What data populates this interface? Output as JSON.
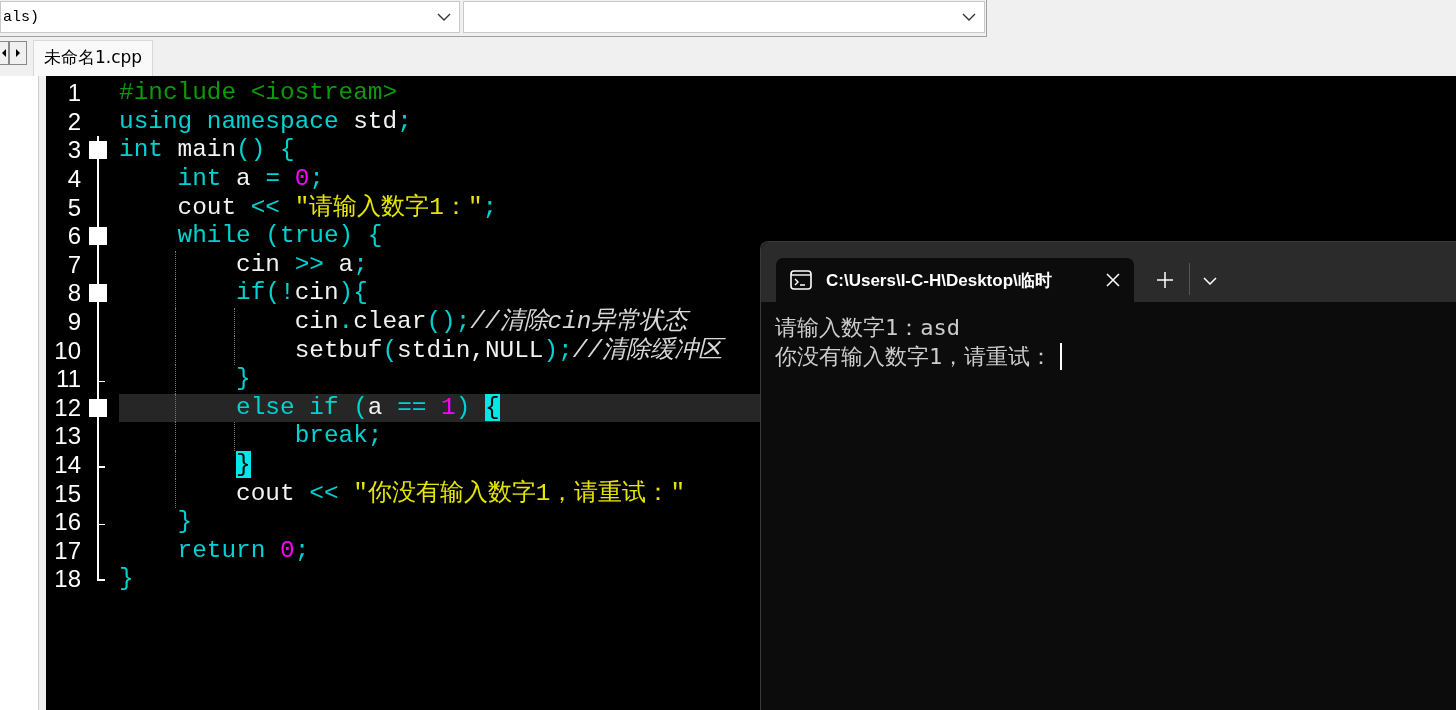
{
  "toolbar": {
    "class_dropdown": {
      "value": "als)"
    }
  },
  "editor_tabs": [
    {
      "label": "未命名1.cpp",
      "selected": true
    }
  ],
  "editor": {
    "lines": [
      {
        "number": "1",
        "kind": "plain",
        "current": false,
        "tokens": [
          {
            "kind": "preprocessor",
            "text": "#include <iostream>"
          }
        ]
      },
      {
        "number": "2",
        "kind": "plain",
        "current": false,
        "tokens": [
          {
            "kind": "keyword",
            "text": "using namespace"
          },
          {
            "kind": "plain",
            "text": " std"
          },
          {
            "kind": "symbol",
            "text": ";"
          }
        ]
      },
      {
        "number": "3",
        "kind": "fold_start",
        "current": false,
        "tokens": [
          {
            "kind": "keyword",
            "text": "int"
          },
          {
            "kind": "plain",
            "text": " main"
          },
          {
            "kind": "symbol",
            "text": "() {"
          }
        ]
      },
      {
        "number": "4",
        "kind": "fold_body",
        "current": false,
        "tokens": [
          {
            "kind": "keyword",
            "text": "    int"
          },
          {
            "kind": "plain",
            "text": " a "
          },
          {
            "kind": "symbol",
            "text": "= "
          },
          {
            "kind": "number",
            "text": "0"
          },
          {
            "kind": "symbol",
            "text": ";"
          }
        ]
      },
      {
        "number": "5",
        "kind": "fold_body",
        "current": false,
        "tokens": [
          {
            "kind": "plain",
            "text": "    cout "
          },
          {
            "kind": "symbol",
            "text": "<< "
          },
          {
            "kind": "string",
            "text": "\"请输入数字1：\""
          },
          {
            "kind": "symbol",
            "text": ";"
          }
        ]
      },
      {
        "number": "6",
        "kind": "fold_start",
        "current": false,
        "tokens": [
          {
            "kind": "keyword",
            "text": "    while"
          },
          {
            "kind": "symbol",
            "text": " ("
          },
          {
            "kind": "keyword",
            "text": "true"
          },
          {
            "kind": "symbol",
            "text": ") {"
          }
        ]
      },
      {
        "number": "7",
        "kind": "fold_body",
        "current": false,
        "tokens": [
          {
            "kind": "plain",
            "text": "        cin "
          },
          {
            "kind": "symbol",
            "text": ">> "
          },
          {
            "kind": "plain",
            "text": "a"
          },
          {
            "kind": "symbol",
            "text": ";"
          }
        ]
      },
      {
        "number": "8",
        "kind": "fold_start",
        "current": false,
        "tokens": [
          {
            "kind": "keyword",
            "text": "        if"
          },
          {
            "kind": "symbol",
            "text": "(!"
          },
          {
            "kind": "plain",
            "text": "cin"
          },
          {
            "kind": "symbol",
            "text": "){"
          }
        ]
      },
      {
        "number": "9",
        "kind": "fold_body",
        "current": false,
        "tokens": [
          {
            "kind": "plain",
            "text": "            cin"
          },
          {
            "kind": "symbol",
            "text": "."
          },
          {
            "kind": "plain",
            "text": "clear"
          },
          {
            "kind": "symbol",
            "text": "();"
          },
          {
            "kind": "comment",
            "text": "//清除cin异常状态"
          }
        ]
      },
      {
        "number": "10",
        "kind": "fold_body",
        "current": false,
        "tokens": [
          {
            "kind": "plain",
            "text": "            setbuf"
          },
          {
            "kind": "symbol",
            "text": "("
          },
          {
            "kind": "plain",
            "text": "stdin,NULL"
          },
          {
            "kind": "symbol",
            "text": ");"
          },
          {
            "kind": "comment",
            "text": "//清除缓冲区"
          }
        ]
      },
      {
        "number": "11",
        "kind": "fold_end",
        "current": false,
        "tokens": [
          {
            "kind": "symbol",
            "text": "        }"
          }
        ]
      },
      {
        "number": "12",
        "kind": "fold_start",
        "current": true,
        "tokens": [
          {
            "kind": "keyword",
            "text": "        else if"
          },
          {
            "kind": "symbol",
            "text": " ("
          },
          {
            "kind": "plain",
            "text": "a "
          },
          {
            "kind": "symbol",
            "text": "== "
          },
          {
            "kind": "number",
            "text": "1"
          },
          {
            "kind": "symbol",
            "text": ") "
          },
          {
            "kind": "brace_match",
            "text": "{"
          }
        ]
      },
      {
        "number": "13",
        "kind": "fold_body",
        "current": false,
        "tokens": [
          {
            "kind": "keyword",
            "text": "            break"
          },
          {
            "kind": "symbol",
            "text": ";"
          }
        ]
      },
      {
        "number": "14",
        "kind": "fold_end",
        "current": false,
        "tokens": [
          {
            "kind": "brace_match",
            "text": "        }"
          }
        ]
      },
      {
        "number": "15",
        "kind": "fold_body",
        "current": false,
        "tokens": [
          {
            "kind": "plain",
            "text": "        cout "
          },
          {
            "kind": "symbol",
            "text": "<< "
          },
          {
            "kind": "string",
            "text": "\"你没有输入数字1，请重试：\""
          }
        ]
      },
      {
        "number": "16",
        "kind": "fold_end",
        "current": false,
        "tokens": [
          {
            "kind": "symbol",
            "text": "    }"
          }
        ]
      },
      {
        "number": "17",
        "kind": "fold_body",
        "current": false,
        "tokens": [
          {
            "kind": "keyword",
            "text": "    return "
          },
          {
            "kind": "number",
            "text": "0"
          },
          {
            "kind": "symbol",
            "text": ";"
          }
        ]
      },
      {
        "number": "18",
        "kind": "fold_last",
        "current": false,
        "tokens": [
          {
            "kind": "symbol",
            "text": "}"
          }
        ]
      }
    ]
  },
  "terminal": {
    "tab_title": "C:\\Users\\I-C-H\\Desktop\\临时",
    "output": [
      "请输入数字1：asd",
      "你没有输入数字1，请重试："
    ]
  }
}
